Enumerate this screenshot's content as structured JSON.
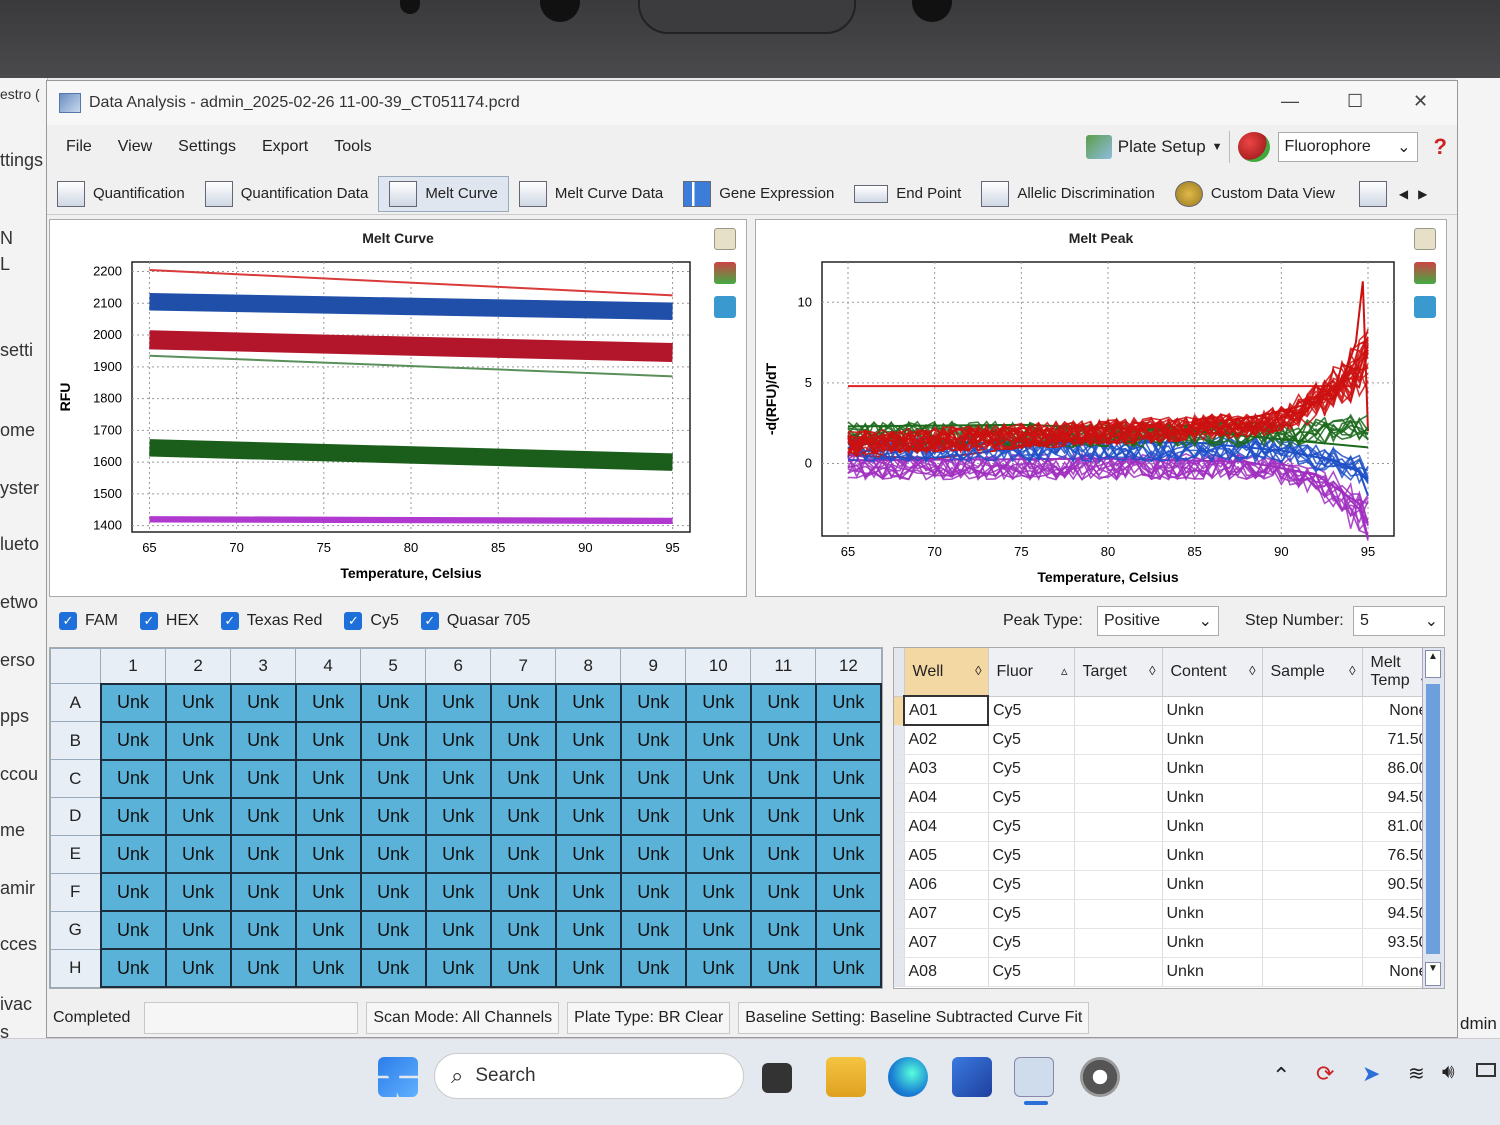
{
  "window": {
    "title": "Data Analysis - admin_2025-02-26 11-00-39_CT051174.pcrd"
  },
  "menu": [
    "File",
    "View",
    "Settings",
    "Export",
    "Tools"
  ],
  "menu_right": {
    "plate_setup": "Plate Setup",
    "fluorophore": "Fluorophore",
    "help": "?"
  },
  "toolbar": [
    "Quantification",
    "Quantification Data",
    "Melt Curve",
    "Melt Curve Data",
    "Gene Expression",
    "End Point",
    "Allelic Discrimination",
    "Custom Data View"
  ],
  "background_window": [
    "estro (",
    "ttings",
    "N",
    "L",
    "setti",
    "ome",
    "yster",
    "lueto",
    "etwo",
    "erso",
    "pps",
    "ccou",
    "me",
    "amir",
    "cces",
    "ivac",
    "s"
  ],
  "right_edge": "dmin",
  "melt_curve": {
    "title": "Melt Curve",
    "xlabel": "Temperature, Celsius",
    "ylabel": "RFU",
    "xticks": [
      "65",
      "70",
      "75",
      "80",
      "85",
      "90",
      "95"
    ],
    "yticks": [
      "1400",
      "1500",
      "1600",
      "1700",
      "1800",
      "1900",
      "2000",
      "2100",
      "2200"
    ]
  },
  "melt_peak": {
    "title": "Melt Peak",
    "xlabel": "Temperature, Celsius",
    "ylabel": "-d(RFU)/dT",
    "xticks": [
      "65",
      "70",
      "75",
      "80",
      "85",
      "90",
      "95"
    ],
    "yticks": [
      "0",
      "5",
      "10"
    ]
  },
  "chart_data": [
    {
      "type": "line",
      "title": "Melt Curve",
      "xlabel": "Temperature, Celsius",
      "ylabel": "RFU",
      "xlim": [
        64,
        96
      ],
      "ylim": [
        1380,
        2230
      ],
      "grid": true,
      "series": [
        {
          "name": "Texas Red",
          "color": "#d93a3a",
          "x": [
            65,
            95
          ],
          "y": [
            2205,
            2125
          ]
        },
        {
          "name": "HEX",
          "color": "#1f4fa8",
          "x": [
            65,
            95
          ],
          "y": [
            2105,
            2075
          ],
          "band": 55
        },
        {
          "name": "Texas Red",
          "color": "#b3162a",
          "x": [
            65,
            95
          ],
          "y": [
            1985,
            1945
          ],
          "band": 60
        },
        {
          "name": "HEX",
          "color": "#5a8f5a",
          "x": [
            65,
            95
          ],
          "y": [
            1935,
            1870
          ]
        },
        {
          "name": "FAM",
          "color": "#1b5e1b",
          "x": [
            65,
            95
          ],
          "y": [
            1645,
            1600
          ],
          "band": 55
        },
        {
          "name": "Quasar 705",
          "color": "#b03ad0",
          "x": [
            65,
            95
          ],
          "y": [
            1420,
            1415
          ],
          "band": 20
        }
      ]
    },
    {
      "type": "line",
      "title": "Melt Peak",
      "xlabel": "Temperature, Celsius",
      "ylabel": "-d(RFU)/dT",
      "xlim": [
        63.5,
        96.5
      ],
      "ylim": [
        -4.5,
        12.5
      ],
      "grid": true,
      "series": [
        {
          "name": "Texas Red",
          "color": "#cc1111",
          "x": [
            65,
            70,
            75,
            80,
            85,
            89,
            92,
            93.5,
            94.3,
            94.7,
            95
          ],
          "y": [
            0.5,
            0.3,
            1,
            1.8,
            2.4,
            3,
            3.8,
            5,
            7.5,
            11.3,
            2
          ]
        },
        {
          "name": "Cy5",
          "color": "#1e50c8",
          "x": [
            65,
            75,
            85,
            90,
            93,
            94.5,
            95
          ],
          "y": [
            1.2,
            1.3,
            1.3,
            0.8,
            0.2,
            -0.5,
            -2
          ]
        },
        {
          "name": "Quasar 705",
          "color": "#a02fc0",
          "x": [
            65,
            80,
            88,
            92,
            94.5,
            95
          ],
          "y": [
            0.2,
            0.3,
            0.1,
            -0.7,
            -2.5,
            -4.6
          ]
        },
        {
          "name": "FAM",
          "color": "#1c6a1c",
          "x": [
            65,
            75,
            85,
            95
          ],
          "y": [
            2.3,
            2.4,
            2.0,
            1.0
          ]
        },
        {
          "name": "Texas Red",
          "color": "#e02020",
          "x": [
            65,
            94
          ],
          "y": [
            4.8,
            4.8
          ]
        }
      ]
    }
  ],
  "fluor_filters": [
    "FAM",
    "HEX",
    "Texas Red",
    "Cy5",
    "Quasar 705"
  ],
  "peak": {
    "label": "Peak Type:",
    "value": "Positive"
  },
  "step": {
    "label": "Step Number:",
    "value": "5"
  },
  "plate": {
    "columns": [
      "1",
      "2",
      "3",
      "4",
      "5",
      "6",
      "7",
      "8",
      "9",
      "10",
      "11",
      "12"
    ],
    "rows": [
      "A",
      "B",
      "C",
      "D",
      "E",
      "F",
      "G",
      "H"
    ],
    "cell_label": "Unk"
  },
  "well_table": {
    "headers": [
      "Well",
      "Fluor",
      "Target",
      "Content",
      "Sample",
      "Melt Temp"
    ],
    "rows": [
      [
        "A01",
        "Cy5",
        "",
        "Unkn",
        "",
        "None"
      ],
      [
        "A02",
        "Cy5",
        "",
        "Unkn",
        "",
        "71.50"
      ],
      [
        "A03",
        "Cy5",
        "",
        "Unkn",
        "",
        "86.00"
      ],
      [
        "A04",
        "Cy5",
        "",
        "Unkn",
        "",
        "94.50"
      ],
      [
        "A04",
        "Cy5",
        "",
        "Unkn",
        "",
        "81.00"
      ],
      [
        "A05",
        "Cy5",
        "",
        "Unkn",
        "",
        "76.50"
      ],
      [
        "A06",
        "Cy5",
        "",
        "Unkn",
        "",
        "90.50"
      ],
      [
        "A07",
        "Cy5",
        "",
        "Unkn",
        "",
        "94.50"
      ],
      [
        "A07",
        "Cy5",
        "",
        "Unkn",
        "",
        "93.50"
      ],
      [
        "A08",
        "Cy5",
        "",
        "Unkn",
        "",
        "None"
      ]
    ]
  },
  "status": [
    "Completed",
    "",
    "Scan Mode: All Channels",
    "Plate Type: BR Clear",
    "Baseline Setting: Baseline Subtracted Curve Fit"
  ],
  "taskbar": {
    "search": "Search"
  }
}
